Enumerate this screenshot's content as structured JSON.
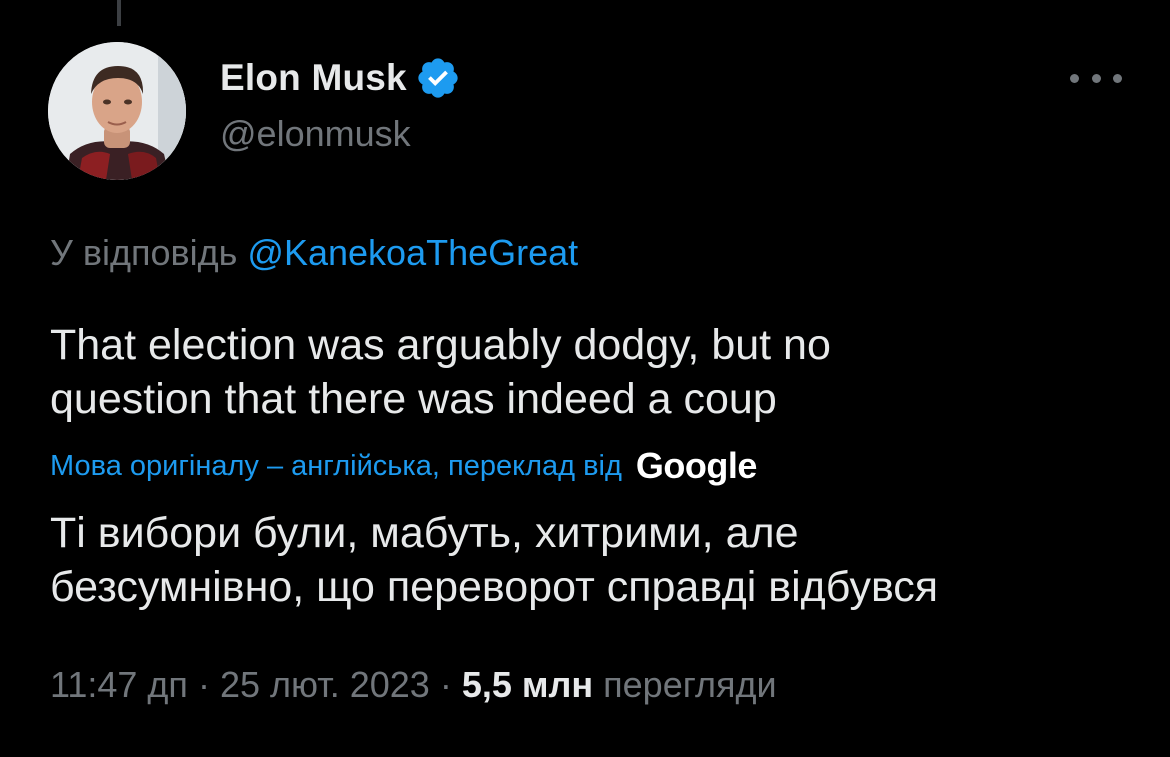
{
  "author": {
    "display_name": "Elon Musk",
    "handle": "@elonmusk",
    "verified": true,
    "avatar_icon": "profile-photo"
  },
  "reply": {
    "prefix": "У відповідь",
    "mention": "@KanekoaTheGreat"
  },
  "tweet": {
    "line1": "That election was arguably dodgy, but no",
    "line2": "question that there was indeed a coup"
  },
  "translation": {
    "label": "Мова оригіналу – англійська, переклад від",
    "provider": "Google",
    "line1": "Ті вибори були, мабуть, хитрими, але",
    "line2": "безсумнівно, що переворот справді відбувся"
  },
  "meta": {
    "time": "11:47 дп",
    "separator": "·",
    "date": "25 лют. 2023",
    "views_count": "5,5 млн",
    "views_label": "перегляди"
  },
  "colors": {
    "background": "#000000",
    "text_primary": "#e7e9ea",
    "text_secondary": "#71767b",
    "accent": "#1d9bf0"
  },
  "icons": {
    "verified": "verified-badge-icon",
    "more": "more-options-icon"
  }
}
